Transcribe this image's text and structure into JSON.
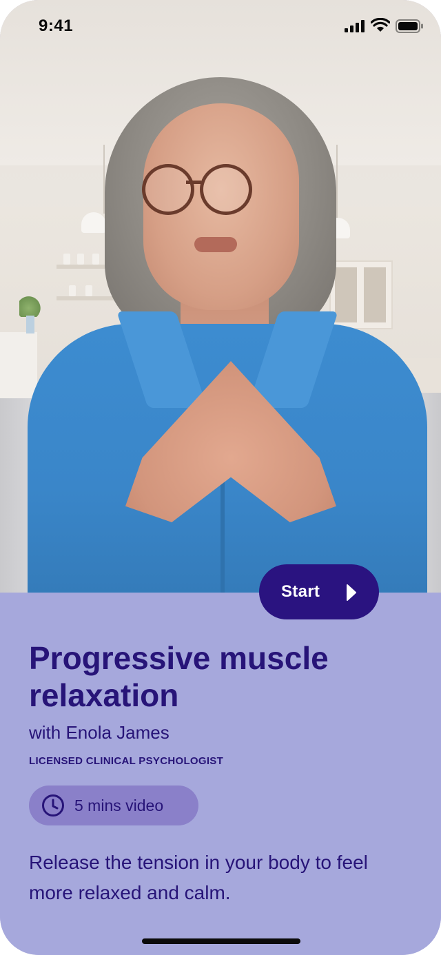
{
  "status_bar": {
    "time": "9:41",
    "icons": [
      "signal-icon",
      "wifi-icon",
      "battery-icon"
    ]
  },
  "hero": {
    "image": "video-thumbnail-woman-in-blue-shirt"
  },
  "start_button": {
    "label": "Start",
    "icon": "play-icon",
    "color": "#2a1380"
  },
  "session": {
    "title": "Progressive muscle relaxation",
    "host": "with Enola James",
    "role": "LICENSED CLINICAL PSYCHOLOGIST",
    "duration": "5 mins video",
    "duration_icon": "clock-icon",
    "description": "Release the tension in your body to feel more relaxed and calm."
  },
  "colors": {
    "panel_background": "#a6a8dc",
    "text": "#271478",
    "chip_background": "#8a80c9"
  }
}
